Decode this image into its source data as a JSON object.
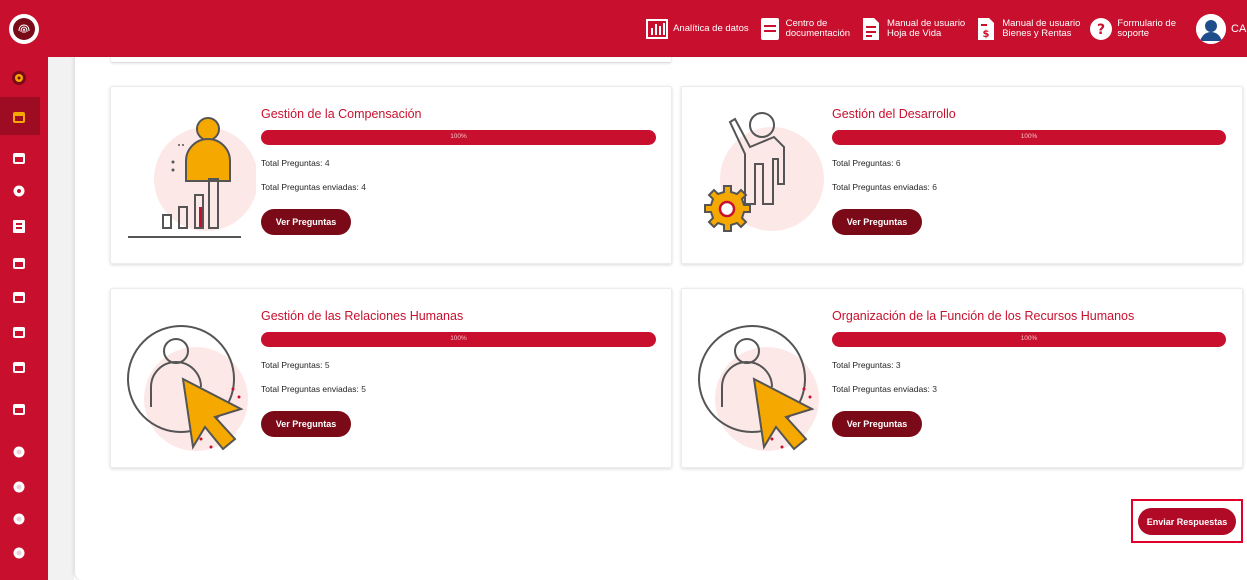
{
  "topbar": {
    "nav": [
      {
        "label": "Analítica de datos",
        "icon": "bar-chart-icon"
      },
      {
        "label": "Centro de\ndocumentación",
        "icon": "document-icon"
      },
      {
        "label": "Manual de usuario\nHoja de Vida",
        "icon": "manual-document-icon"
      },
      {
        "label": "Manual de usuario\nBienes y Rentas",
        "icon": "money-document-icon"
      },
      {
        "label": "Formulario de\nsoporte",
        "icon": "help-icon"
      }
    ],
    "user_initials": "CA"
  },
  "cards": [
    {
      "title": "Gestión de la Compensación",
      "progress_label": "100%",
      "progress": 1.0,
      "total_label": "Total Preguntas:",
      "total_value": "4",
      "sent_label": "Total Preguntas enviadas:",
      "sent_value": "4",
      "button": "Ver Preguntas",
      "illustration": "compensation-icon"
    },
    {
      "title": "Gestión del Desarrollo",
      "progress_label": "100%",
      "progress": 1.0,
      "total_label": "Total Preguntas:",
      "total_value": "6",
      "sent_label": "Total Preguntas enviadas:",
      "sent_value": "6",
      "button": "Ver Preguntas",
      "illustration": "development-gear-icon"
    },
    {
      "title": "Gestión de las Relaciones Humanas",
      "progress_label": "100%",
      "progress": 1.0,
      "total_label": "Total Preguntas:",
      "total_value": "5",
      "sent_label": "Total Preguntas enviadas:",
      "sent_value": "5",
      "button": "Ver Preguntas",
      "illustration": "user-cursor-icon"
    },
    {
      "title": "Organización de la Función de los Recursos Humanos",
      "progress_label": "100%",
      "progress": 1.0,
      "total_label": "Total Preguntas:",
      "total_value": "3",
      "sent_label": "Total Preguntas enviadas:",
      "sent_value": "3",
      "button": "Ver Preguntas",
      "illustration": "user-cursor-icon"
    }
  ],
  "submit_button": "Enviar Respuestas",
  "colors": {
    "brand": "#c8102e",
    "button_dark": "#7a0a18",
    "accent_yellow": "#f5a800"
  }
}
